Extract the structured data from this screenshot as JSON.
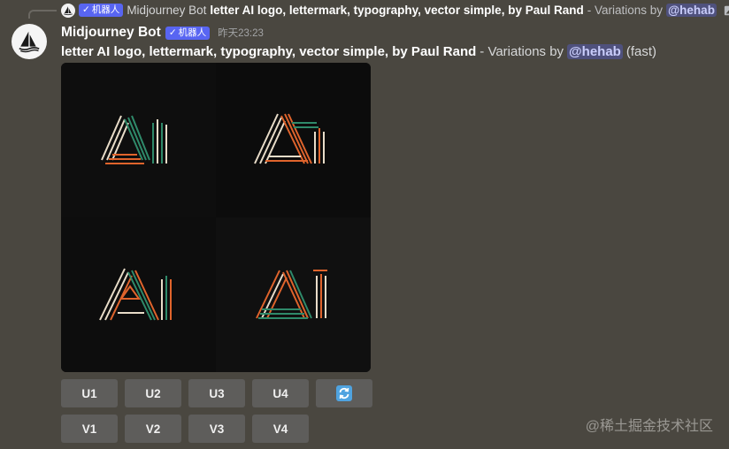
{
  "reply": {
    "author": "Midjourney Bot",
    "badge": "机器人",
    "prompt": "letter AI logo, lettermark, typography, vector simple, by Paul Rand",
    "suffix": "- Variations by",
    "mention": "@hehab"
  },
  "message": {
    "author": "Midjourney Bot",
    "badge": "机器人",
    "timestamp": "昨天23:23",
    "prompt": "letter AI logo, lettermark, typography, vector simple, by Paul Rand",
    "suffix": "- Variations by",
    "mention": "@hehab",
    "mode": "(fast)"
  },
  "images": [
    {
      "icon": "ai-logo-variation-1"
    },
    {
      "icon": "ai-logo-variation-2"
    },
    {
      "icon": "ai-logo-variation-3"
    },
    {
      "icon": "ai-logo-variation-4"
    }
  ],
  "buttons": {
    "upscale": [
      "U1",
      "U2",
      "U3",
      "U4"
    ],
    "variation": [
      "V1",
      "V2",
      "V3",
      "V4"
    ],
    "reroll_icon": "refresh-icon"
  },
  "colors": {
    "bot_badge": "#5865f2",
    "accent_orange": "#e0642c",
    "accent_green": "#2f8a6a",
    "accent_cream": "#e8dcc8"
  },
  "watermark": "@稀土掘金技术社区"
}
